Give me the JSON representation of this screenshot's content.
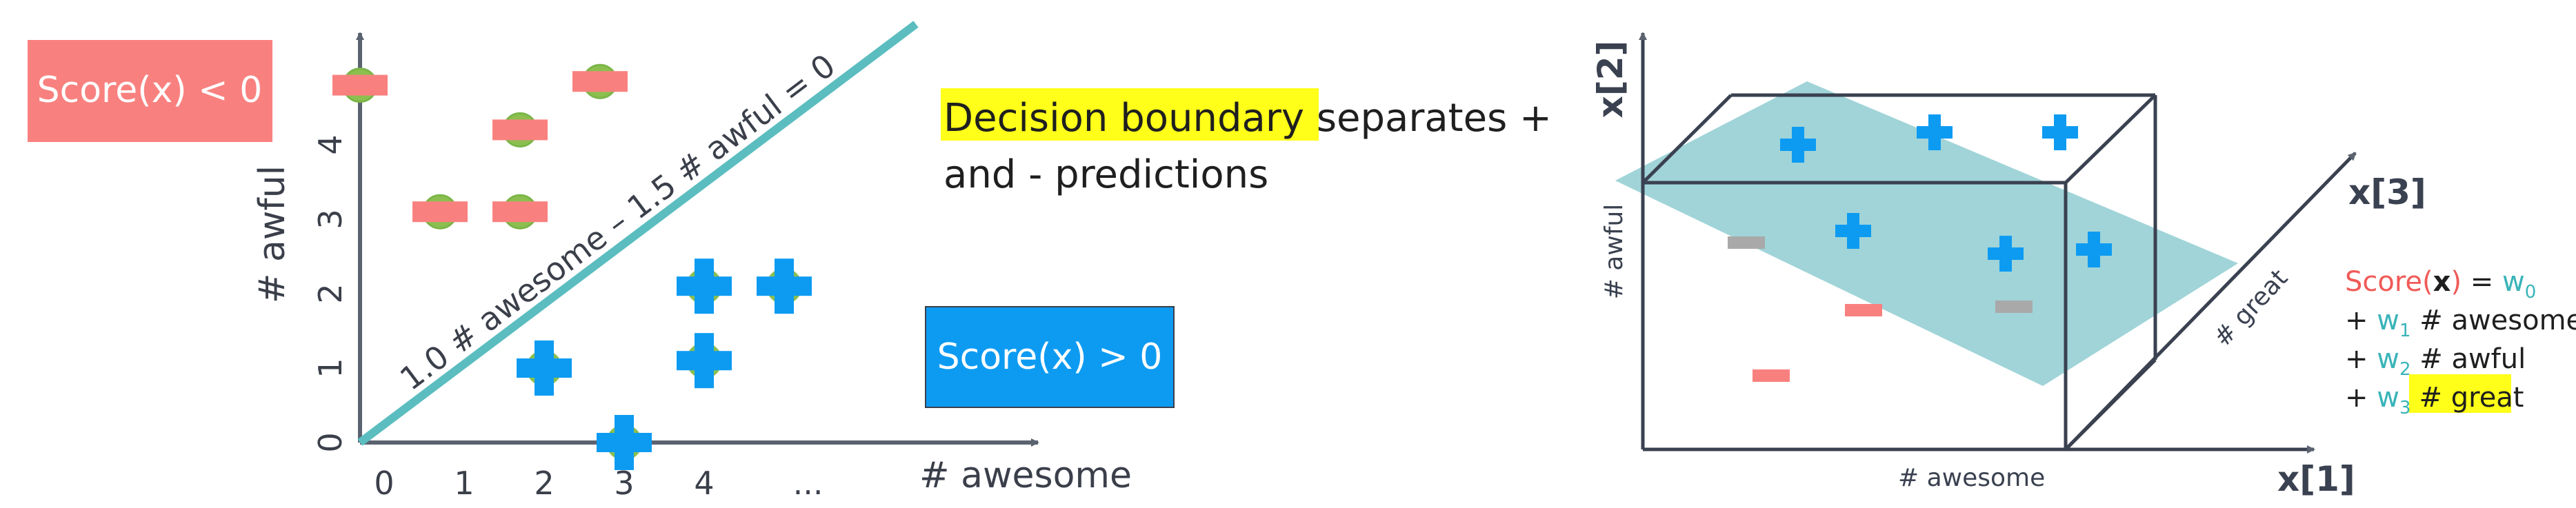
{
  "left_plot": {
    "x_axis_label": "# awesome",
    "y_axis_label": "# awful",
    "x_ticks": [
      "0",
      "1",
      "2",
      "3",
      "4",
      "..."
    ],
    "y_ticks": [
      "0",
      "1",
      "2",
      "3",
      "4"
    ],
    "boundary_equation": "1.0 # awesome – 1.5 # awful = 0",
    "negative_region_label": "Score(x) < 0",
    "positive_region_label": "Score(x) > 0",
    "negative_points": [
      {
        "awesome": 0,
        "awful": 4.8
      },
      {
        "awesome": 1,
        "awful": 3.1
      },
      {
        "awesome": 2,
        "awful": 3.1
      },
      {
        "awesome": 2,
        "awful": 4.2
      },
      {
        "awesome": 3,
        "awful": 4.85
      }
    ],
    "positive_points": [
      {
        "awesome": 2,
        "awful": 1
      },
      {
        "awesome": 3,
        "awful": 0
      },
      {
        "awesome": 4,
        "awful": 1.1
      },
      {
        "awesome": 4,
        "awful": 2.1
      },
      {
        "awesome": 5,
        "awful": 2.1
      }
    ],
    "colors": {
      "negative": "#f8817f",
      "positive": "#0d9bf2",
      "boundary": "#5bbdbf",
      "point_outline": "#7ab648"
    }
  },
  "middle_text": {
    "highlight": "Decision boundary",
    "rest_line1": " separates +",
    "line2": "and - predictions",
    "highlight_color": "#ffff19"
  },
  "right_plot": {
    "axis_x_label": "x[1]",
    "axis_y_label": "x[2]",
    "axis_z_label": "x[3]",
    "edge_x_label": "# awesome",
    "edge_y_label": "# awful",
    "edge_z_label": "# great",
    "plane_color": "#96cfd4",
    "minus_gray_color": "#a9a9a9"
  },
  "score_formula": {
    "line1_score": "Score(",
    "line1_x": "x",
    "line1_close": ")",
    "line1_eq": " = ",
    "line1_w": "w",
    "line1_sub": "0",
    "line2_plus": "+ ",
    "line2_w": "w",
    "line2_sub": "1",
    "line2_feat": " # awesome",
    "line3_plus": "+ ",
    "line3_w": "w",
    "line3_sub": "2",
    "line3_feat": " # awful",
    "line4_plus": "+ ",
    "line4_w": "w",
    "line4_sub": "3",
    "line4_feat": "# great",
    "score_color": "#f05a57",
    "w_color": "#39b4b9"
  }
}
